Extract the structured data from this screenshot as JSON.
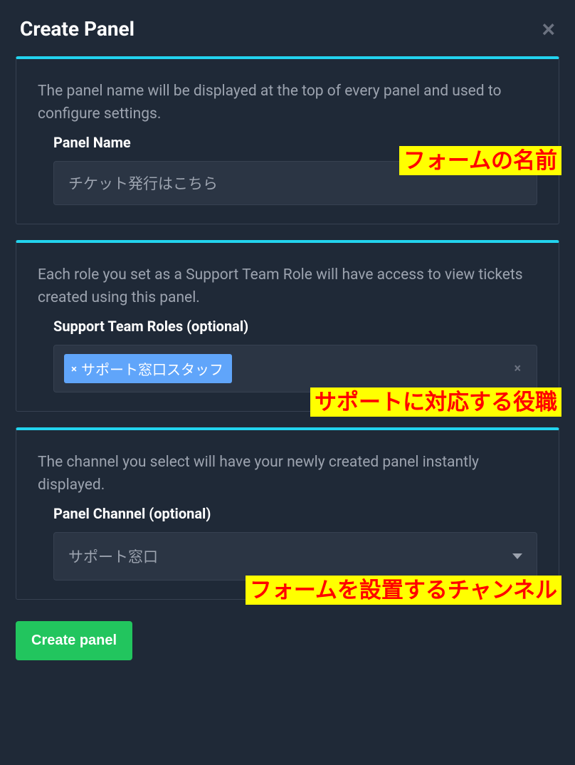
{
  "header": {
    "title": "Create Panel"
  },
  "section1": {
    "desc": "The panel name will be displayed at the top of every panel and used to configure settings.",
    "label": "Panel Name",
    "value": "チケット発行はこちら",
    "annotation": "フォームの名前"
  },
  "section2": {
    "desc": "Each role you set as a Support Team Role will have access to view tickets created using this panel.",
    "label": "Support Team Roles (optional)",
    "tag": "サポート窓口スタッフ",
    "annotation": "サポートに対応する役職"
  },
  "section3": {
    "desc": "The channel you select will have your newly created panel instantly displayed.",
    "label": "Panel Channel (optional)",
    "value": "サポート窓口",
    "annotation": "フォームを設置するチャンネル"
  },
  "footer": {
    "create_label": "Create panel"
  }
}
